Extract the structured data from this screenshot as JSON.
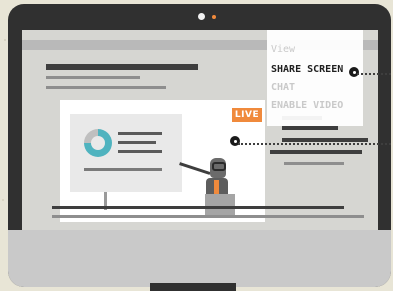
{
  "video": {
    "live_badge": "LIVE"
  },
  "menu": {
    "items": [
      {
        "label": "View",
        "active": false
      },
      {
        "label": "SHARE SCREEN",
        "active": true
      },
      {
        "label": "CHAT",
        "active": false
      },
      {
        "label": "ENABLE VIDEO",
        "active": false
      }
    ]
  },
  "colors": {
    "accent": "#f08a3c",
    "chart_teal": "#4fb3bf",
    "monitor_frame": "#303030",
    "screen_bg": "#d6d6d2"
  }
}
